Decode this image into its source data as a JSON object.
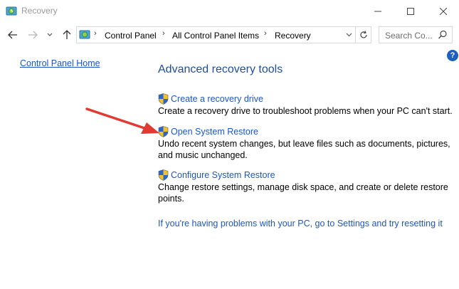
{
  "window": {
    "title": "Recovery"
  },
  "address": {
    "crumbs": [
      "Control Panel",
      "All Control Panel Items",
      "Recovery"
    ],
    "search_placeholder": "Search Co..."
  },
  "left_pane": {
    "home_link": "Control Panel Home"
  },
  "main": {
    "heading": "Advanced recovery tools",
    "tools": [
      {
        "label": "Create a recovery drive",
        "description": "Create a recovery drive to troubleshoot problems when your PC can't start."
      },
      {
        "label": "Open System Restore",
        "description": "Undo recent system changes, but leave files such as documents, pictures, and music unchanged."
      },
      {
        "label": "Configure System Restore",
        "description": "Change restore settings, manage disk space, and create or delete restore points."
      }
    ],
    "reset_link": "If you're having problems with your PC, go to Settings and try resetting it"
  },
  "colors": {
    "link": "#1a56c8",
    "heading": "#1e4e9c",
    "annotation_arrow": "#e03a32"
  },
  "icons": {
    "app": "control-panel-recovery-icon",
    "shield": "uac-shield-icon",
    "help": "help-icon"
  }
}
